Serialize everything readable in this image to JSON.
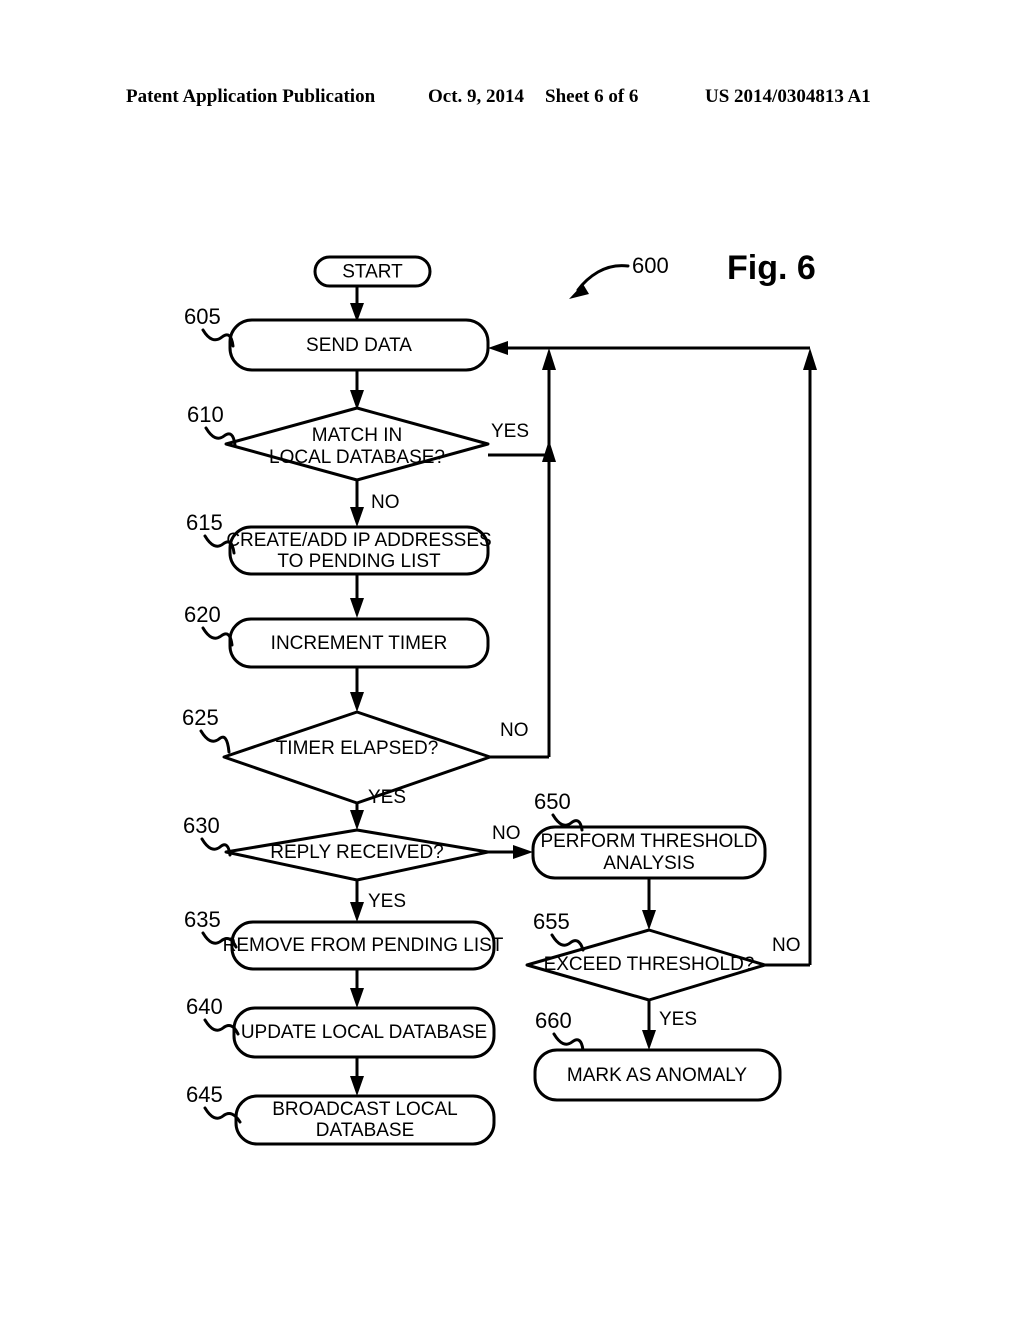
{
  "header": {
    "publication": "Patent Application Publication",
    "date": "Oct. 9, 2014",
    "sheet": "Sheet 6 of 6",
    "patent_number": "US 2014/0304813 A1"
  },
  "figure": {
    "label": "Fig. 6",
    "diagram_ref": "600",
    "colors": {
      "ink": "#000000",
      "paper": "#ffffff"
    }
  },
  "nodes": {
    "start": {
      "ref": "",
      "label": "START",
      "type": "terminator"
    },
    "n605": {
      "ref": "605",
      "label": "SEND DATA",
      "type": "process"
    },
    "n610": {
      "ref": "610",
      "label_line1": "MATCH IN",
      "label_line2": "LOCAL DATABASE?",
      "type": "decision"
    },
    "n615": {
      "ref": "615",
      "label_line1": "CREATE/ADD IP ADDRESSES",
      "label_line2": "TO PENDING LIST",
      "type": "process"
    },
    "n620": {
      "ref": "620",
      "label": "INCREMENT TIMER",
      "type": "process"
    },
    "n625": {
      "ref": "625",
      "label": "TIMER ELAPSED?",
      "type": "decision"
    },
    "n630": {
      "ref": "630",
      "label": "REPLY RECEIVED?",
      "type": "decision"
    },
    "n635": {
      "ref": "635",
      "label": "REMOVE FROM PENDING LIST",
      "type": "process"
    },
    "n640": {
      "ref": "640",
      "label": "UPDATE LOCAL DATABASE",
      "type": "process"
    },
    "n645": {
      "ref": "645",
      "label_line1": "BROADCAST LOCAL",
      "label_line2": "DATABASE",
      "type": "process"
    },
    "n650": {
      "ref": "650",
      "label_line1": "PERFORM THRESHOLD",
      "label_line2": "ANALYSIS",
      "type": "process"
    },
    "n655": {
      "ref": "655",
      "label": "EXCEED THRESHOLD?",
      "type": "decision"
    },
    "n660": {
      "ref": "660",
      "label": "MARK AS ANOMALY",
      "type": "process"
    }
  },
  "edge_labels": {
    "e610_yes": "YES",
    "e610_no": "NO",
    "e625_no": "NO",
    "e625_yes": "YES",
    "e630_no": "NO",
    "e630_yes": "YES",
    "e655_no": "NO",
    "e655_yes": "YES"
  },
  "chart_data": {
    "type": "diagram",
    "title": "Fig. 6",
    "diagram_ref": "600",
    "flow": [
      {
        "id": "start",
        "label": "START",
        "shape": "terminator",
        "next": [
          "605"
        ]
      },
      {
        "id": "605",
        "label": "SEND DATA",
        "shape": "process",
        "next": [
          "610"
        ]
      },
      {
        "id": "610",
        "label": "MATCH IN LOCAL DATABASE?",
        "shape": "decision",
        "branches": [
          {
            "label": "YES",
            "to": "605"
          },
          {
            "label": "NO",
            "to": "615"
          }
        ]
      },
      {
        "id": "615",
        "label": "CREATE/ADD IP ADDRESSES TO PENDING LIST",
        "shape": "process",
        "next": [
          "620"
        ]
      },
      {
        "id": "620",
        "label": "INCREMENT TIMER",
        "shape": "process",
        "next": [
          "625"
        ]
      },
      {
        "id": "625",
        "label": "TIMER ELAPSED?",
        "shape": "decision",
        "branches": [
          {
            "label": "NO",
            "to": "605"
          },
          {
            "label": "YES",
            "to": "630"
          }
        ]
      },
      {
        "id": "630",
        "label": "REPLY RECEIVED?",
        "shape": "decision",
        "branches": [
          {
            "label": "NO",
            "to": "650"
          },
          {
            "label": "YES",
            "to": "635"
          }
        ]
      },
      {
        "id": "635",
        "label": "REMOVE FROM PENDING LIST",
        "shape": "process",
        "next": [
          "640"
        ]
      },
      {
        "id": "640",
        "label": "UPDATE LOCAL DATABASE",
        "shape": "process",
        "next": [
          "645"
        ]
      },
      {
        "id": "645",
        "label": "BROADCAST LOCAL DATABASE",
        "shape": "process",
        "next": []
      },
      {
        "id": "650",
        "label": "PERFORM THRESHOLD ANALYSIS",
        "shape": "process",
        "next": [
          "655"
        ]
      },
      {
        "id": "655",
        "label": "EXCEED THRESHOLD?",
        "shape": "decision",
        "branches": [
          {
            "label": "NO",
            "to": "605"
          },
          {
            "label": "YES",
            "to": "660"
          }
        ]
      },
      {
        "id": "660",
        "label": "MARK AS ANOMALY",
        "shape": "process",
        "next": []
      }
    ]
  }
}
